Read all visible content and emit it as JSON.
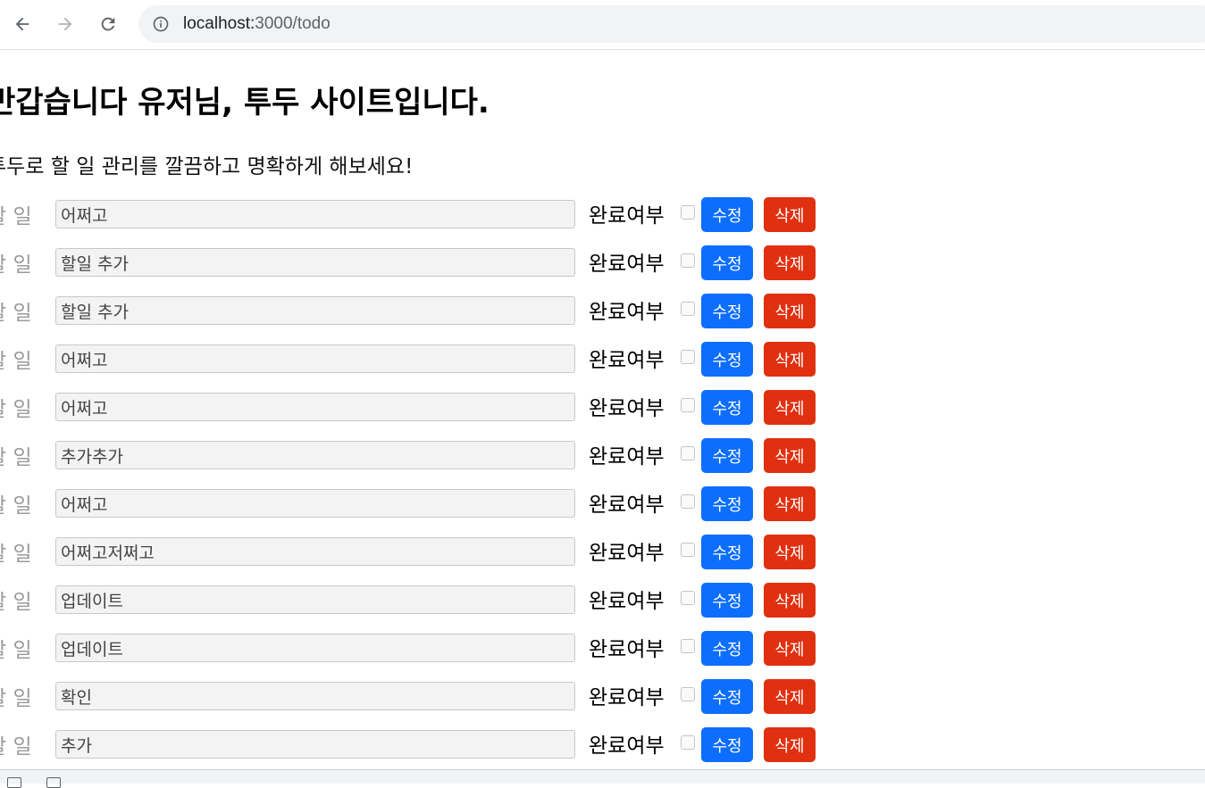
{
  "browser": {
    "url_host": "localhost:",
    "url_path": "3000/todo"
  },
  "page": {
    "title": "반갑습니다 유저님, 투두 사이트입니다.",
    "subtitle": "투두로 할 일 관리를 깔끔하고 명확하게 해보세요!"
  },
  "todos": [
    {
      "label": "할 일",
      "value": "어쩌고",
      "done_label": "완료여부",
      "edit_label": "수정",
      "delete_label": "삭제"
    },
    {
      "label": "할 일",
      "value": "할일 추가",
      "done_label": "완료여부",
      "edit_label": "수정",
      "delete_label": "삭제"
    },
    {
      "label": "할 일",
      "value": "할일 추가",
      "done_label": "완료여부",
      "edit_label": "수정",
      "delete_label": "삭제"
    },
    {
      "label": "할 일",
      "value": "어쩌고",
      "done_label": "완료여부",
      "edit_label": "수정",
      "delete_label": "삭제"
    },
    {
      "label": "할 일",
      "value": "어쩌고",
      "done_label": "완료여부",
      "edit_label": "수정",
      "delete_label": "삭제"
    },
    {
      "label": "할 일",
      "value": "추가추가",
      "done_label": "완료여부",
      "edit_label": "수정",
      "delete_label": "삭제"
    },
    {
      "label": "할 일",
      "value": "어쩌고",
      "done_label": "완료여부",
      "edit_label": "수정",
      "delete_label": "삭제"
    },
    {
      "label": "할 일",
      "value": "어쩌고저쩌고",
      "done_label": "완료여부",
      "edit_label": "수정",
      "delete_label": "삭제"
    },
    {
      "label": "할 일",
      "value": "업데이트",
      "done_label": "완료여부",
      "edit_label": "수정",
      "delete_label": "삭제"
    },
    {
      "label": "할 일",
      "value": "업데이트",
      "done_label": "완료여부",
      "edit_label": "수정",
      "delete_label": "삭제"
    },
    {
      "label": "할 일",
      "value": "확인",
      "done_label": "완료여부",
      "edit_label": "수정",
      "delete_label": "삭제"
    },
    {
      "label": "할 일",
      "value": "추가",
      "done_label": "완료여부",
      "edit_label": "수정",
      "delete_label": "삭제"
    }
  ],
  "icons": {
    "back": "arrow-left-icon",
    "forward": "arrow-right-icon",
    "reload": "reload-icon",
    "info": "info-icon"
  },
  "colors": {
    "edit_button": "#0d6efd",
    "delete_button": "#e0300f"
  }
}
